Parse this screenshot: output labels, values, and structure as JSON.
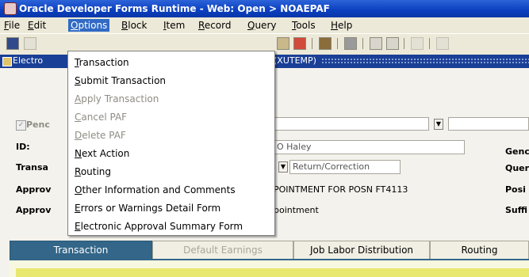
{
  "window": {
    "title": "Oracle Developer Forms Runtime - Web:  Open > NOAEPAF"
  },
  "menubar": {
    "items": [
      {
        "id": "file",
        "ul": "F",
        "rest": "ile"
      },
      {
        "id": "edit",
        "ul": "E",
        "rest": "dit"
      },
      {
        "id": "options",
        "ul": "O",
        "rest": "ptions"
      },
      {
        "id": "block",
        "ul": "B",
        "rest": "lock"
      },
      {
        "id": "item",
        "ul": "I",
        "rest": "tem"
      },
      {
        "id": "record",
        "ul": "R",
        "rest": "ecord"
      },
      {
        "id": "query",
        "ul": "Q",
        "rest": "uery"
      },
      {
        "id": "tools",
        "ul": "T",
        "rest": "ools"
      },
      {
        "id": "help",
        "ul": "H",
        "rest": "elp"
      }
    ]
  },
  "form": {
    "title_left": "Electro",
    "title_right": "(XUTEMP)",
    "pending_label": "Penc",
    "id_label": "ID:",
    "name_value": "O Haley",
    "gender_label": "Genc",
    "transaction_label": "Transa",
    "transaction_status": "Return/Correction",
    "query_label": "Quer",
    "approval1_label": "Approv",
    "approval1_value": "POINTMENT FOR POSN FT4113",
    "position_label": "Posi",
    "approval2_label": "Approv",
    "approval2_value": "pointment",
    "suffix_label": "Suffi"
  },
  "options_menu": {
    "items": [
      {
        "ul": "T",
        "rest": "ransaction",
        "enabled": true
      },
      {
        "ul": "S",
        "rest": "ubmit Transaction",
        "enabled": true
      },
      {
        "ul": "A",
        "rest": "pply Transaction",
        "enabled": false
      },
      {
        "ul": "C",
        "rest": "ancel PAF",
        "enabled": false
      },
      {
        "ul": "D",
        "rest": "elete PAF",
        "enabled": false
      },
      {
        "ul": "N",
        "rest": "ext Action",
        "enabled": true
      },
      {
        "ul": "R",
        "rest": "outing",
        "enabled": true
      },
      {
        "ul": "O",
        "rest": "ther Information and Comments",
        "enabled": true
      },
      {
        "ul": "E",
        "rest": "rrors or Warnings Detail Form",
        "enabled": true
      },
      {
        "ul": "E",
        "rest": "lectronic Approval Summary Form",
        "enabled": true
      }
    ]
  },
  "tabs": [
    {
      "label": "Transaction",
      "state": "active"
    },
    {
      "label": "Default Earnings",
      "state": "disabled"
    },
    {
      "label": "Job Labor Distribution",
      "state": "normal"
    },
    {
      "label": "Routing",
      "state": "normal"
    }
  ]
}
